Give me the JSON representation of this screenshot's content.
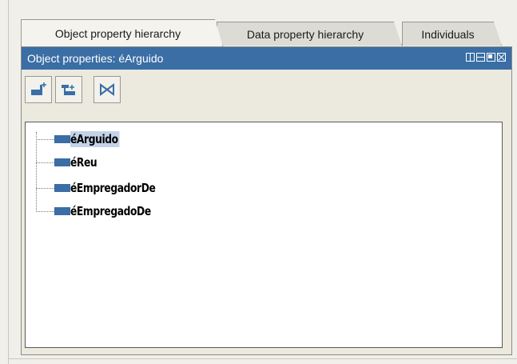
{
  "tabs": [
    {
      "label": "Object property hierarchy",
      "active": true
    },
    {
      "label": "Data property hierarchy",
      "active": false
    },
    {
      "label": "Individuals",
      "active": false
    }
  ],
  "panel": {
    "title": "Object properties: éArguido",
    "title_bar_color": "#3a6ea5"
  },
  "toolbar": {
    "buttons": [
      {
        "icon": "add-subproperty-icon"
      },
      {
        "icon": "add-sibling-property-icon"
      },
      {
        "icon": "delete-property-icon"
      }
    ]
  },
  "tree": {
    "items": [
      {
        "label": "éArguido",
        "selected": true,
        "icon": "object-property-icon"
      },
      {
        "label": "éReu",
        "selected": false,
        "icon": "object-property-icon"
      },
      {
        "label": "éEmpregadorDe",
        "selected": false,
        "icon": "object-property-icon"
      },
      {
        "label": "éEmpregadoDe",
        "selected": false,
        "icon": "object-property-icon"
      }
    ],
    "selection_color": "#c4d3e8",
    "property_icon_color": "#3a6ea5"
  }
}
